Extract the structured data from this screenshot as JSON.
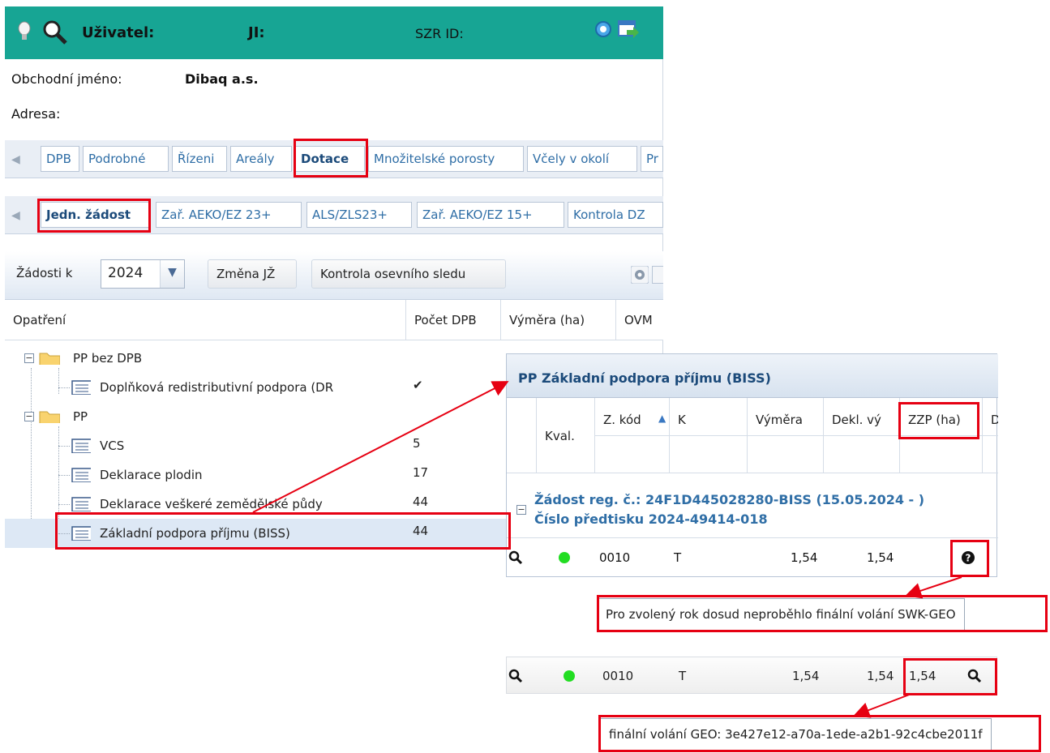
{
  "header": {
    "user_label": "Uživatel:",
    "ji_label": "JI:",
    "szr_label": "SZR ID:",
    "icons": [
      "bulb-icon",
      "search-icon",
      "refresh-icon",
      "export-icon"
    ]
  },
  "subject": {
    "business_name_label": "Obchodní jméno:",
    "business_name_value": "Dibaq a.s.",
    "address_label": "Adresa:"
  },
  "main_tabs": [
    "DPB",
    "Podrobné",
    "Řízeni",
    "Areály",
    "Dotace",
    "Množitelské porosty",
    "Včely v okolí",
    "Pr"
  ],
  "main_tabs_active": "Dotace",
  "sub_tabs": [
    "Jedn. žádost",
    "Zař. AEKO/EZ 23+",
    "ALS/ZLS23+",
    "Zař. AEKO/EZ 15+",
    "Kontrola DZ"
  ],
  "sub_tabs_active": "Jedn. žádost",
  "toolbar": {
    "year_label": "Žádosti k",
    "year_value": "2024",
    "change_button": "Změna JŽ",
    "check_button": "Kontrola osevního sledu"
  },
  "grid": {
    "columns": [
      "Opatření",
      "Počet DPB",
      "Výměra (ha)",
      "OVM"
    ],
    "rows": [
      {
        "label": "PP bez DPB",
        "count": "",
        "level": 0,
        "type": "folder"
      },
      {
        "label": "Doplňková redistributivní podpora (DR",
        "count": "✔",
        "level": 1,
        "type": "node"
      },
      {
        "label": "PP",
        "count": "",
        "level": 0,
        "type": "folder"
      },
      {
        "label": "VCS",
        "count": "5",
        "level": 1,
        "type": "node"
      },
      {
        "label": "Deklarace plodin",
        "count": "17",
        "level": 1,
        "type": "node"
      },
      {
        "label": "Deklarace veškeré zemědělské půdy",
        "count": "44",
        "level": 1,
        "type": "node"
      },
      {
        "label": "Základní podpora příjmu (BISS)",
        "count": "44",
        "level": 1,
        "type": "node",
        "selected": true
      }
    ]
  },
  "popup": {
    "title": "PP Základní podpora příjmu (BISS)",
    "columns": [
      "Kval.",
      "Z. kód",
      "K",
      "Výměra",
      "Dekl. vý",
      "ZZP (ha)",
      "D"
    ],
    "group_line1": "Žádost reg. č.: 24F1D445028280-BISS (15.05.2024 - )",
    "group_line2": "Číslo předtisku 2024-49414-018",
    "row": {
      "code": "0010",
      "k": "T",
      "vymera": "1,54",
      "dekl": "1,54"
    }
  },
  "tooltip1": "Pro zvolený rok dosud neproběhlo finální volání SWK-GEO",
  "row2": {
    "code": "0010",
    "k": "T",
    "vymera": "1,54",
    "dekl": "1,54",
    "zzp": "1,54"
  },
  "tooltip2": "finální volání GEO: 3e427e12-a70a-1ede-a2b1-92c4cbe2011f",
  "colors": {
    "header_teal": "#17a594",
    "annotation_red": "#e60012",
    "link_blue": "#2f6ea6",
    "status_green": "#22dd22"
  }
}
